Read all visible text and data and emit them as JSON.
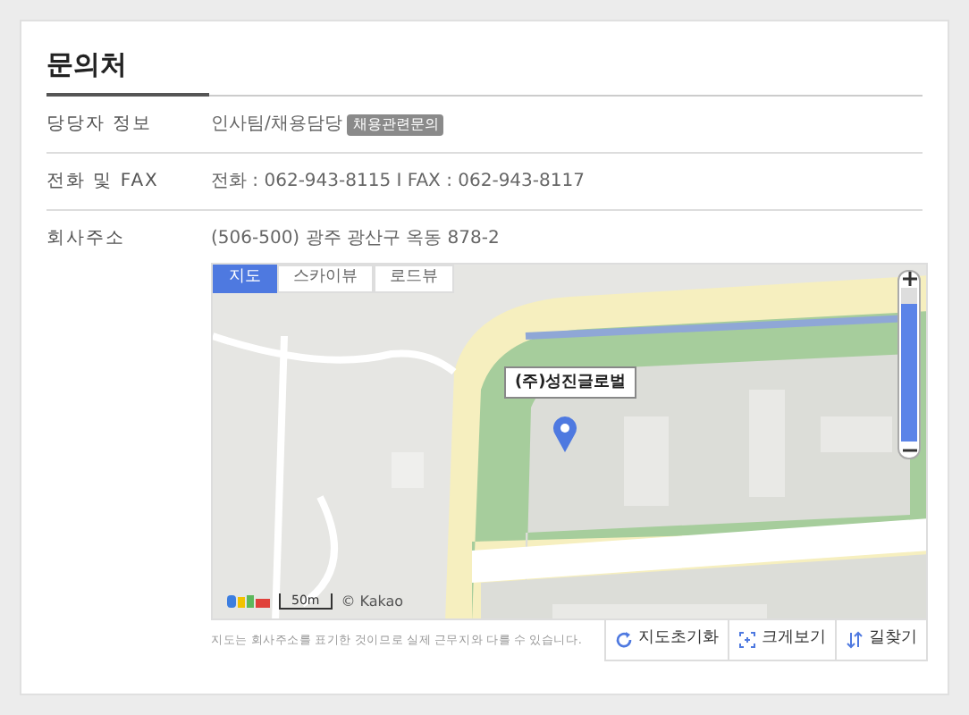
{
  "section_title": "문의처",
  "rows": [
    {
      "label": "당당자 정보",
      "value": "인사팀/채용담당",
      "badge": "채용관련문의"
    },
    {
      "label": "전화 및 FAX",
      "value": "전화 : 062-943-8115 I FAX : 062-943-8117"
    },
    {
      "label": "회사주소",
      "value": "(506-500) 광주 광산구 옥동 878-2"
    }
  ],
  "map": {
    "kind": "picture",
    "tabs": [
      {
        "label": "지도",
        "selected": true
      },
      {
        "label": "스카이뷰",
        "selected": false
      },
      {
        "label": "로드뷰",
        "selected": false
      }
    ],
    "zoom": {
      "level": 0.9
    },
    "marker_label": "(주)성진글로벌",
    "scale": "50m",
    "copyright": "© Kakao"
  },
  "map_note": "지도는 회사주소를 표기한 것이므로 실제 근무지와 다를 수 있습니다.",
  "map_buttons": [
    {
      "kind": "reset",
      "label": "지도초기화"
    },
    {
      "kind": "enlarge",
      "label": "크게보기"
    },
    {
      "kind": "route",
      "label": "길찾기"
    }
  ]
}
